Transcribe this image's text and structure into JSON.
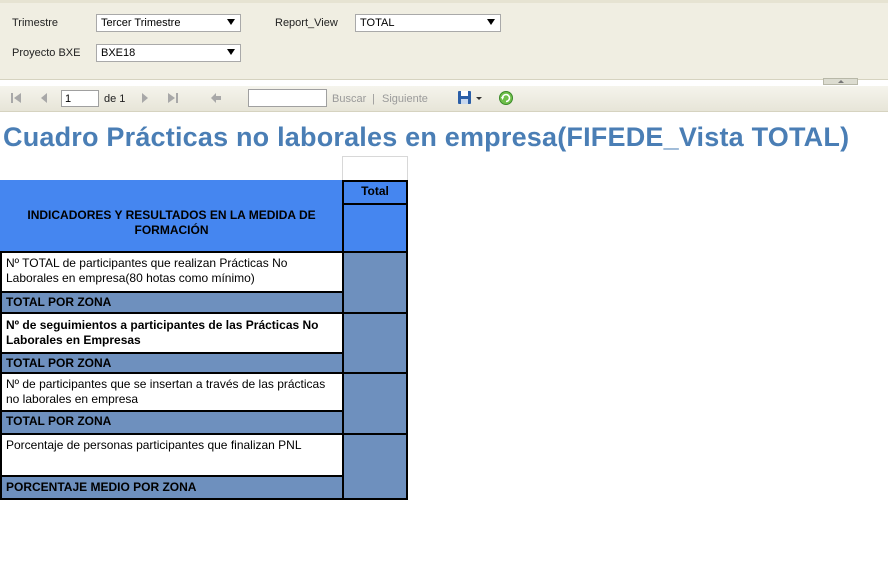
{
  "params": {
    "trimestre_label": "Trimestre",
    "trimestre_value": "Tercer Trimestre",
    "report_view_label": "Report_View",
    "report_view_value": "TOTAL",
    "proyecto_label": "Proyecto BXE",
    "proyecto_value": "BXE18"
  },
  "toolbar": {
    "page_value": "1",
    "of_label": "de 1",
    "find_label": "Buscar",
    "separator": "|",
    "next_label": "Siguiente",
    "find_value": ""
  },
  "report": {
    "title": "Cuadro Prácticas no laborales en empresa(FIFEDE_Vista TOTAL)",
    "total_header": "Total",
    "indicators_header": "INDICADORES Y RESULTADOS EN LA MEDIDA DE FORMACIÓN",
    "rows": [
      {
        "label": "Nº TOTAL de participantes que realizan Prácticas No Laborales en empresa(80 hotas como mínimo)",
        "subtotal": "TOTAL POR ZONA"
      },
      {
        "label": "Nº de seguimientos a participantes de las Prácticas No Laborales en Empresas",
        "subtotal": "TOTAL POR ZONA"
      },
      {
        "label": "Nº de participantes que se insertan a través de las prácticas no laborales en empresa",
        "subtotal": "TOTAL POR ZONA"
      },
      {
        "label": "Porcentaje de personas participantes que finalizan PNL",
        "subtotal": "PORCENTAJE MEDIO POR ZONA"
      }
    ]
  },
  "colors": {
    "title": "#4a7eb5",
    "header_blue": "#4586f0",
    "value_cell": "#6e90be"
  }
}
